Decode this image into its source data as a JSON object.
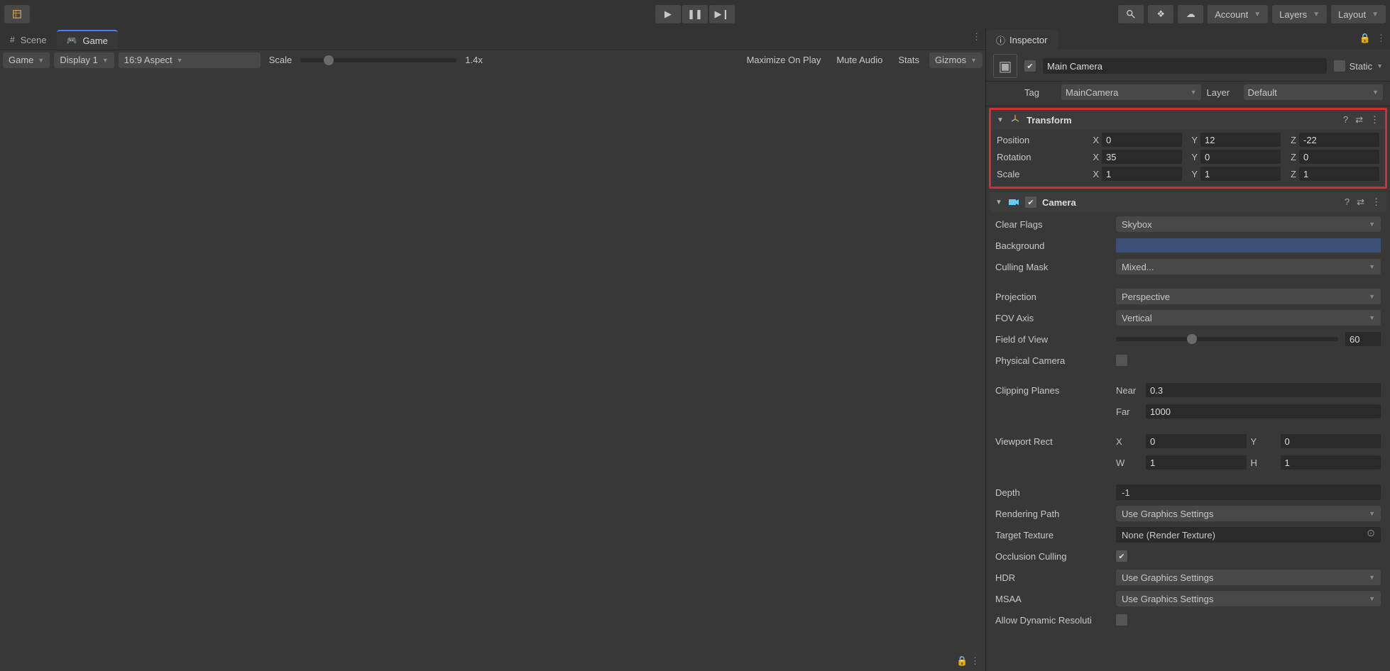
{
  "topbar": {
    "account": "Account",
    "layers": "Layers",
    "layout": "Layout"
  },
  "tabs": {
    "scene": "Scene",
    "game": "Game"
  },
  "toolbar": {
    "game_select": "Game",
    "display": "Display 1",
    "aspect": "16:9 Aspect",
    "scale_label": "Scale",
    "scale_value": "1.4x",
    "maximize": "Maximize On Play",
    "mute": "Mute Audio",
    "stats": "Stats",
    "gizmos": "Gizmos"
  },
  "inspector": {
    "tab": "Inspector",
    "object_name": "Main Camera",
    "static": "Static",
    "tag_label": "Tag",
    "tag_value": "MainCamera",
    "layer_label": "Layer",
    "layer_value": "Default"
  },
  "transform": {
    "title": "Transform",
    "position_label": "Position",
    "rotation_label": "Rotation",
    "scale_label": "Scale",
    "pos": {
      "x": "0",
      "y": "12",
      "z": "-22"
    },
    "rot": {
      "x": "35",
      "y": "0",
      "z": "0"
    },
    "scl": {
      "x": "1",
      "y": "1",
      "z": "1"
    }
  },
  "camera": {
    "title": "Camera",
    "clear_flags_label": "Clear Flags",
    "clear_flags_value": "Skybox",
    "background_label": "Background",
    "culling_label": "Culling Mask",
    "culling_value": "Mixed...",
    "projection_label": "Projection",
    "projection_value": "Perspective",
    "fov_axis_label": "FOV Axis",
    "fov_axis_value": "Vertical",
    "fov_label": "Field of View",
    "fov_value": "60",
    "physical_label": "Physical Camera",
    "clipping_label": "Clipping Planes",
    "near_label": "Near",
    "near_value": "0.3",
    "far_label": "Far",
    "far_value": "1000",
    "viewport_label": "Viewport Rect",
    "vx": "0",
    "vy": "0",
    "vw": "1",
    "vh": "1",
    "depth_label": "Depth",
    "depth_value": "-1",
    "render_label": "Rendering Path",
    "render_value": "Use Graphics Settings",
    "target_label": "Target Texture",
    "target_value": "None (Render Texture)",
    "occlusion_label": "Occlusion Culling",
    "hdr_label": "HDR",
    "hdr_value": "Use Graphics Settings",
    "msaa_label": "MSAA",
    "msaa_value": "Use Graphics Settings",
    "dynres_label": "Allow Dynamic Resoluti"
  },
  "axes": {
    "x": "X",
    "y": "Y",
    "z": "Z",
    "w": "W",
    "h": "H"
  }
}
